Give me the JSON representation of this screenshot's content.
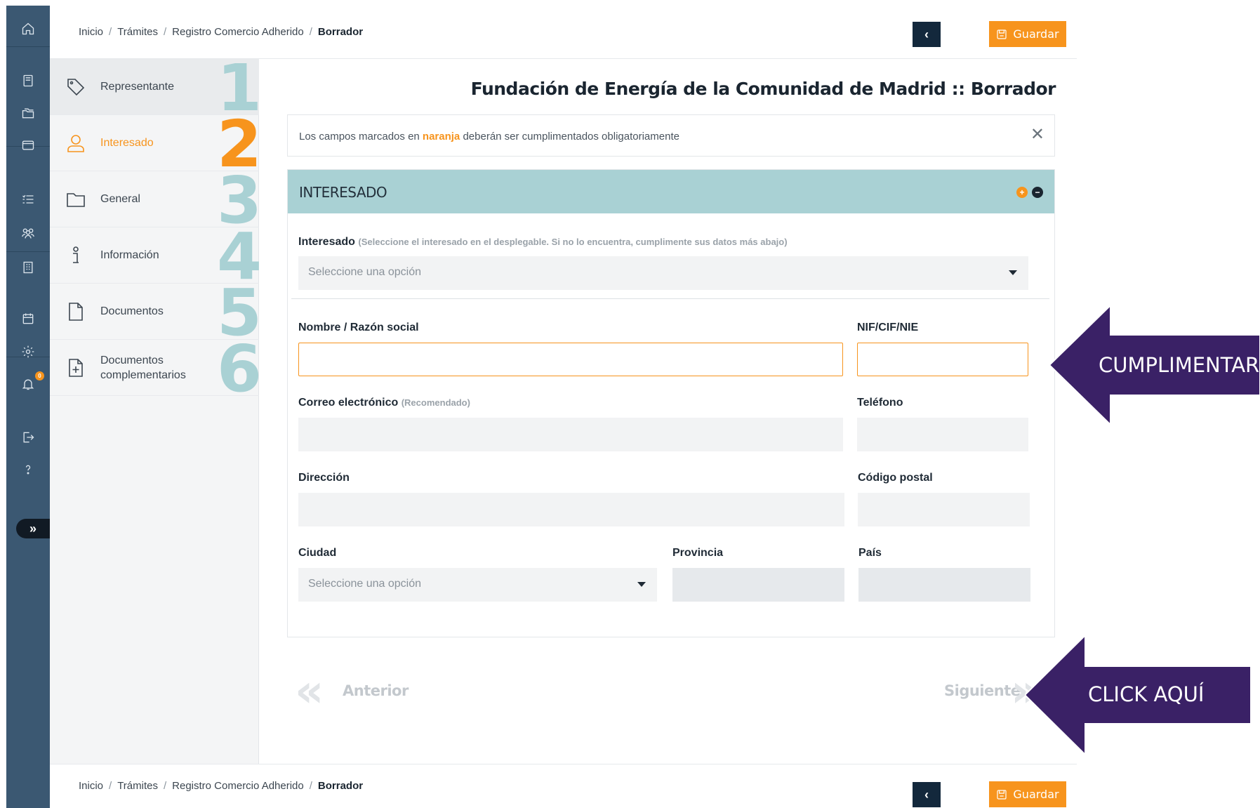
{
  "breadcrumb": {
    "items": [
      "Inicio",
      "Trámites",
      "Registro Comercio Adherido"
    ],
    "current": "Borrador",
    "separator": "/"
  },
  "toolbar": {
    "back_label": "‹",
    "save_label": "Guardar"
  },
  "sidebar_rail": {
    "icons": [
      "home-icon",
      "book-icon",
      "folders-icon",
      "inbox-icon",
      "checklist-icon",
      "users-icon",
      "building-icon",
      "calendar-icon",
      "gear-icon",
      "bell-icon",
      "logout-icon",
      "help-icon"
    ],
    "notification_badge": "0",
    "expand_label": "»"
  },
  "steps": [
    {
      "label": "Representante",
      "number": "1",
      "icon": "tag-icon"
    },
    {
      "label": "Interesado",
      "number": "2",
      "icon": "user-icon"
    },
    {
      "label": "General",
      "number": "3",
      "icon": "folder-icon"
    },
    {
      "label": "Información",
      "number": "4",
      "icon": "info-icon"
    },
    {
      "label": "Documentos",
      "number": "5",
      "icon": "document-icon"
    },
    {
      "label": "Documentos complementarios",
      "number": "6",
      "icon": "document-plus-icon"
    }
  ],
  "page_title": "Fundación de Energía de la Comunidad de Madrid :: Borrador",
  "notice": {
    "before": "Los campos marcados en ",
    "highlight": "naranja",
    "after": " deberán ser cumplimentados obligatoriamente",
    "close": "✕"
  },
  "section": {
    "title": "INTERESADO",
    "toggle_a": "+",
    "toggle_b": "−"
  },
  "form": {
    "interesado_label": "Interesado",
    "interesado_note": "(Seleccione el interesado en el desplegable. Si no lo encuentra, cumplimente sus datos más abajo)",
    "interesado_placeholder": "Seleccione una opción",
    "nombre_label": "Nombre / Razón social",
    "nombre_value": "",
    "nif_label": "NIF/CIF/NIE",
    "nif_value": "",
    "correo_label": "Correo electrónico",
    "correo_note": "(Recomendado)",
    "correo_value": "",
    "telefono_label": "Teléfono",
    "telefono_value": "",
    "direccion_label": "Dirección",
    "direccion_value": "",
    "cp_label": "Código postal",
    "cp_value": "",
    "ciudad_label": "Ciudad",
    "ciudad_placeholder": "Seleccione una opción",
    "provincia_label": "Provincia",
    "provincia_value": "",
    "pais_label": "País",
    "pais_value": ""
  },
  "navigation": {
    "prev_label": "Anterior",
    "next_label": "Siguiente",
    "prev_chevron": "«",
    "next_chevron": "»"
  },
  "annotations": {
    "fill_callout": "CUMPLIMENTAR",
    "click_callout": "CLICK AQUÍ",
    "callout_color": "#3a2166"
  },
  "colors": {
    "accent": "#f7941d",
    "rail": "#3b5872",
    "section_header": "#a9d1d4",
    "dark": "#13283c"
  }
}
